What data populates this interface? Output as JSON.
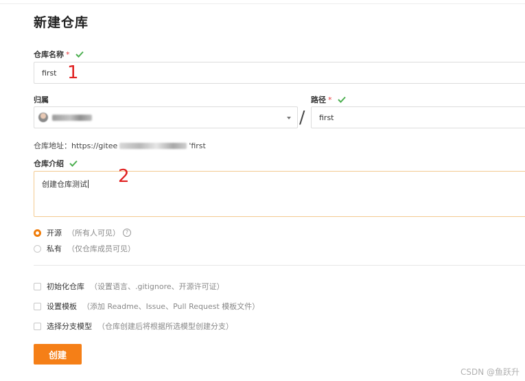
{
  "page": {
    "title": "新建仓库"
  },
  "repo_name": {
    "label": "仓库名称",
    "required_mark": "*",
    "value": "first",
    "annotation": "1"
  },
  "owner": {
    "label": "归属"
  },
  "path_field": {
    "label": "路径",
    "required_mark": "*",
    "value": "first",
    "separator": "/"
  },
  "address": {
    "prefix": "仓库地址：https://gitee",
    "suffix": "'first"
  },
  "description": {
    "label": "仓库介绍",
    "value": "创建仓库测试",
    "annotation": "2"
  },
  "visibility": {
    "options": [
      {
        "label": "开源",
        "hint": "（所有人可见）",
        "selected": true
      },
      {
        "label": "私有",
        "hint": "（仅仓库成员可见）",
        "selected": false
      }
    ]
  },
  "init_options": [
    {
      "label": "初始化仓库",
      "hint": "（设置语言、.gitignore、开源许可证）"
    },
    {
      "label": "设置模板",
      "hint": "（添加 Readme、Issue、Pull Request 模板文件）"
    },
    {
      "label": "选择分支模型",
      "hint": "（仓库创建后将根据所选模型创建分支）"
    }
  ],
  "create_button": {
    "label": "创建"
  },
  "watermark": "CSDN @鱼跃升",
  "colors": {
    "accent": "#f57f17",
    "check_green": "#4caf50",
    "annotation_red": "#e02020",
    "required_red": "#e4393c"
  },
  "icons": {
    "valid": "check-icon",
    "help": "question-circle-icon",
    "dropdown": "caret-down-icon"
  }
}
